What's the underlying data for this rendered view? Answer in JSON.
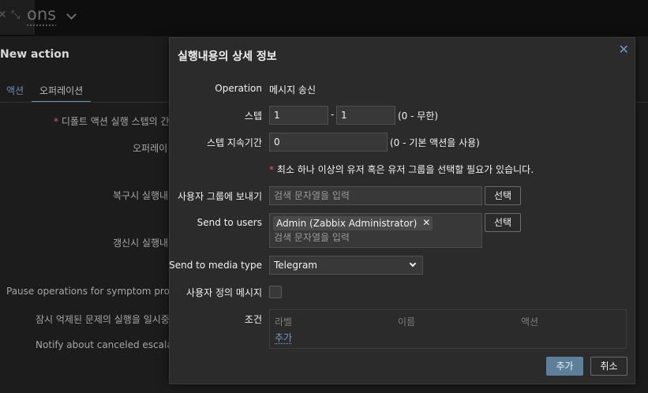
{
  "background": {
    "top_icons": [
      "close-icon",
      "fullscreen-icon"
    ],
    "page_title": "ons",
    "panel_title": "New action",
    "tabs": [
      "액션",
      "오퍼레이션"
    ],
    "labels": {
      "default_step": "디폴트 액션 실행 스텝의 간",
      "operations": "오퍼레이",
      "recovery": "복구시 실행내",
      "update": "갱신시 실행내",
      "pause_symptom": "Pause operations for symptom problem",
      "pause_suppressed": "잠시 억제된 문제의 실행을 일시중",
      "notify_canceled": "Notify about canceled escalation"
    }
  },
  "modal": {
    "title": "실행내용의 상세 정보",
    "operation": {
      "label": "Operation",
      "value": "메시지 송신"
    },
    "steps": {
      "label": "스텝",
      "from": "1",
      "sep": "-",
      "to": "1",
      "hint": "(0 - 무한)"
    },
    "step_duration": {
      "label": "스텝 지속기간",
      "value": "0",
      "hint": "(0 - 기본 액션을 사용)"
    },
    "required_note": "최소 하나 이상의 유저 혹은 유저 그룹을 선택할 필요가 있습니다.",
    "user_groups": {
      "label": "사용자 그룹에 보내기",
      "placeholder": "검색 문자열을 입력",
      "button": "선택"
    },
    "users": {
      "label": "Send to users",
      "selected": "Admin (Zabbix Administrator)",
      "placeholder": "검색 문자열을 입력",
      "button": "선택"
    },
    "media_type": {
      "label": "Send to media type",
      "value": "Telegram"
    },
    "custom_message": {
      "label": "사용자 정의 메시지",
      "checked": false
    },
    "conditions": {
      "label": "조건",
      "columns": [
        "라벨",
        "이름",
        "액션"
      ],
      "add_link": "추가"
    },
    "footer": {
      "add": "추가",
      "cancel": "취소"
    }
  },
  "colors": {
    "accent": "#5c7f9a",
    "link": "#6e9bbf",
    "required": "#e45959",
    "modal_bg": "#2b2b2b"
  }
}
